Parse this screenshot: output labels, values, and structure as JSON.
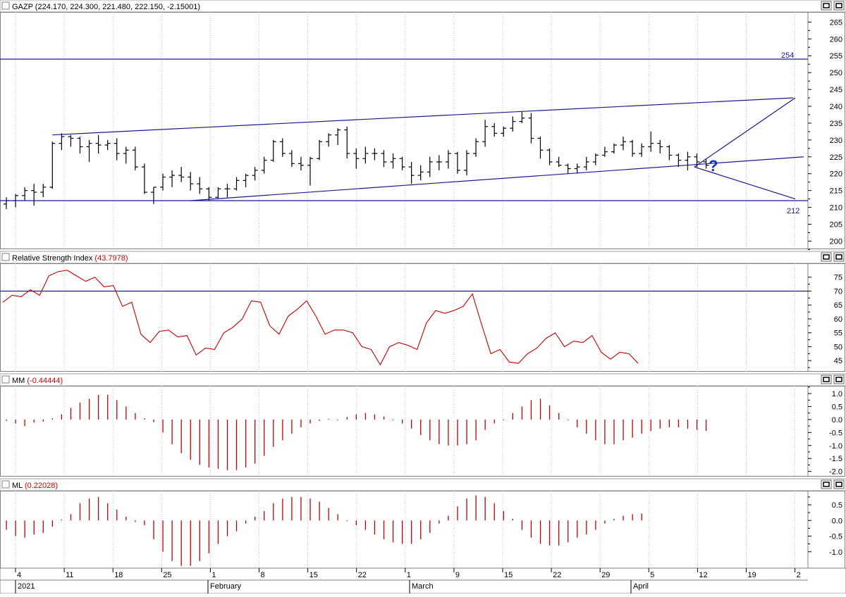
{
  "price_panel": {
    "title": "GAZP (224.170, 224.300, 221.480, 222.150, -2.15001)",
    "level_high_label": "254",
    "level_low_label": "212",
    "question_mark": "?"
  },
  "rsi_panel": {
    "title_prefix": "Relative Strength Index",
    "title_value": "(43.7978)"
  },
  "mm_panel": {
    "title_prefix": "MM",
    "title_value": "(-0.44444)"
  },
  "ml_panel": {
    "title_prefix": "ML",
    "title_value": "(0.22028)"
  },
  "window_buttons": {
    "restore": "□",
    "maximize": "□"
  },
  "colors": {
    "price": "#000000",
    "lines": "#1a1a8c",
    "indicator": "#c00000",
    "grid": "#c0c0c0"
  },
  "chart_data": [
    {
      "type": "ohlc",
      "ticker": "GAZP",
      "ylim": [
        198,
        268
      ],
      "yticks": [
        200,
        205,
        210,
        215,
        220,
        225,
        230,
        235,
        240,
        245,
        250,
        255,
        260,
        265
      ],
      "x_tick_labels": [
        "4",
        "11",
        "18",
        "25",
        "1",
        "8",
        "15",
        "22",
        "1",
        "9",
        "15",
        "22",
        "29",
        "5",
        "12",
        "19",
        "2"
      ],
      "month_labels": [
        "2021",
        "February",
        "March",
        "April"
      ],
      "ohlc": [
        [
          211,
          213,
          209.5,
          212
        ],
        [
          212,
          214,
          210,
          213.5
        ],
        [
          213.5,
          216,
          212,
          215
        ],
        [
          215,
          217,
          210.5,
          214.5
        ],
        [
          214.5,
          217,
          213,
          216
        ],
        [
          216,
          229.5,
          215.5,
          229
        ],
        [
          229,
          232,
          227,
          231
        ],
        [
          231,
          231.5,
          228,
          230.5
        ],
        [
          230.5,
          231,
          226,
          228
        ],
        [
          228,
          230,
          223.5,
          229
        ],
        [
          229,
          231.5,
          226,
          228.5
        ],
        [
          228.5,
          230,
          227,
          229
        ],
        [
          229,
          230.5,
          224,
          226
        ],
        [
          226,
          228,
          223,
          227
        ],
        [
          227,
          228,
          221,
          222
        ],
        [
          222,
          223,
          214,
          214.5
        ],
        [
          214.5,
          216,
          211,
          216
        ],
        [
          216,
          220,
          215,
          219
        ],
        [
          219,
          221,
          216,
          219.5
        ],
        [
          219.5,
          222,
          217.5,
          219
        ],
        [
          219,
          220.5,
          215,
          217
        ],
        [
          217,
          219,
          214,
          215.5
        ],
        [
          215.5,
          216,
          212,
          213
        ],
        [
          213,
          216,
          212.5,
          215.5
        ],
        [
          215.5,
          217,
          213,
          215.5
        ],
        [
          215.5,
          219,
          215,
          218
        ],
        [
          218,
          220,
          216,
          219.5
        ],
        [
          219.5,
          222,
          218,
          221
        ],
        [
          221,
          225,
          220,
          224
        ],
        [
          224,
          230,
          223.5,
          229.5
        ],
        [
          229.5,
          230.5,
          225,
          226
        ],
        [
          226,
          227,
          222,
          223
        ],
        [
          223,
          225,
          221,
          222.5
        ],
        [
          222.5,
          225,
          216.5,
          224.5
        ],
        [
          224.5,
          230,
          224,
          229.5
        ],
        [
          229.5,
          232,
          228,
          231.5
        ],
        [
          231.5,
          233.5,
          228.5,
          233
        ],
        [
          233,
          234,
          224.5,
          226
        ],
        [
          226,
          227.5,
          221.5,
          224.5
        ],
        [
          224.5,
          228,
          223,
          226
        ],
        [
          226,
          227.5,
          224,
          226
        ],
        [
          226,
          227,
          222,
          223.5
        ],
        [
          223.5,
          226,
          221.5,
          224.5
        ],
        [
          224.5,
          225,
          221,
          222
        ],
        [
          222,
          223.5,
          217,
          219.5
        ],
        [
          219.5,
          222.5,
          218,
          220.5
        ],
        [
          220.5,
          225,
          219,
          223.5
        ],
        [
          223.5,
          225.5,
          221,
          223.5
        ],
        [
          223.5,
          227,
          221.5,
          226
        ],
        [
          226,
          226.5,
          220,
          221
        ],
        [
          221,
          227,
          219.5,
          226
        ],
        [
          226,
          230.5,
          225,
          229.5
        ],
        [
          229.5,
          236,
          228,
          234
        ],
        [
          234,
          235,
          231,
          232
        ],
        [
          232,
          234,
          231,
          233.5
        ],
        [
          233.5,
          237,
          232.5,
          235.5
        ],
        [
          235.5,
          238.5,
          235,
          236.5
        ],
        [
          236.5,
          238,
          229,
          230.5
        ],
        [
          230.5,
          231,
          224.5,
          227
        ],
        [
          227,
          227.5,
          222.5,
          223.5
        ],
        [
          223.5,
          225,
          222,
          222.5
        ],
        [
          222.5,
          223,
          220,
          221.5
        ],
        [
          221.5,
          223,
          220,
          222
        ],
        [
          222,
          225,
          221,
          223.5
        ],
        [
          223.5,
          226,
          222.5,
          225.5
        ],
        [
          225.5,
          228,
          225,
          226.5
        ],
        [
          226.5,
          229,
          226,
          228.5
        ],
        [
          228.5,
          231,
          227,
          229.5
        ],
        [
          229.5,
          230,
          225,
          226
        ],
        [
          226,
          229,
          225,
          228
        ],
        [
          228,
          232.5,
          226.5,
          229
        ],
        [
          229,
          230,
          226,
          228
        ],
        [
          228,
          228.5,
          224,
          225.5
        ],
        [
          225.5,
          226,
          222,
          224
        ],
        [
          224,
          226.5,
          221,
          225
        ],
        [
          225,
          226,
          222,
          223.5
        ],
        [
          223.5,
          224.5,
          221.5,
          222.5
        ]
      ],
      "levels": [
        254,
        212
      ],
      "channel_top": {
        "from": [
          5,
          231.5
        ],
        "to": [
          79,
          242.5
        ]
      },
      "channel_bottom": {
        "from": [
          20,
          212
        ],
        "to": [
          79,
          225
        ]
      },
      "projection_up": {
        "from": [
          69,
          222
        ],
        "to": [
          79,
          242.5
        ]
      },
      "projection_down": {
        "from": [
          69,
          222
        ],
        "to": [
          79,
          212.5
        ]
      }
    },
    {
      "type": "line",
      "name": "Relative Strength Index",
      "ylim": [
        41,
        80
      ],
      "yticks": [
        45,
        50,
        55,
        60,
        65,
        70,
        75
      ],
      "reference_line": 70,
      "values": [
        66,
        68.5,
        68,
        70.5,
        68.5,
        75.5,
        77,
        77.5,
        75.5,
        73.5,
        75,
        71.5,
        72,
        64.5,
        66,
        54.5,
        51.5,
        55.5,
        56,
        53.5,
        54,
        47,
        49.5,
        49,
        55,
        57,
        60,
        66.5,
        66,
        57.5,
        54.5,
        61,
        63.5,
        66.5,
        61,
        54.5,
        56,
        56,
        55,
        50,
        49,
        43.5,
        50,
        51.5,
        50.5,
        49,
        58.5,
        63,
        62,
        63,
        64.5,
        69,
        58,
        47.5,
        49,
        44.5,
        44,
        47.5,
        49.5,
        53,
        55,
        50,
        52,
        51.5,
        54,
        48,
        45.5,
        48,
        47.5,
        44
      ]
    },
    {
      "type": "bar",
      "name": "MM",
      "ylim": [
        -2.2,
        1.3
      ],
      "yticks": [
        1.0,
        0.5,
        0.0,
        -0.5,
        -1.0,
        -1.5,
        -2.0
      ],
      "values": [
        -0.05,
        -0.15,
        -0.25,
        -0.12,
        -0.08,
        0.05,
        0.2,
        0.45,
        0.65,
        0.8,
        0.95,
        0.95,
        0.75,
        0.5,
        0.25,
        0.05,
        -0.1,
        -0.5,
        -0.95,
        -1.3,
        -1.55,
        -1.75,
        -1.85,
        -1.9,
        -1.95,
        -1.95,
        -1.85,
        -1.7,
        -1.4,
        -1.05,
        -0.8,
        -0.55,
        -0.3,
        -0.15,
        -0.05,
        0.03,
        0,
        0.1,
        0.2,
        0.25,
        0.2,
        0.12,
        0,
        -0.15,
        -0.35,
        -0.6,
        -0.8,
        -0.95,
        -1.0,
        -1.0,
        -0.95,
        -0.8,
        -0.4,
        -0.15,
        0,
        0.25,
        0.5,
        0.75,
        0.8,
        0.55,
        0.25,
        0,
        -0.3,
        -0.55,
        -0.8,
        -0.95,
        -0.95,
        -0.8,
        -0.7,
        -0.55,
        -0.45,
        -0.35,
        -0.3,
        -0.3,
        -0.35,
        -0.4,
        -0.44
      ]
    },
    {
      "type": "bar",
      "name": "ML",
      "ylim": [
        -1.5,
        0.95
      ],
      "yticks": [
        0.5,
        0.0,
        -0.5,
        -1.0
      ],
      "values": [
        -0.3,
        -0.5,
        -0.55,
        -0.45,
        -0.4,
        -0.2,
        0.03,
        0.2,
        0.55,
        0.7,
        0.75,
        0.55,
        0.35,
        0.12,
        -0.05,
        -0.15,
        -0.6,
        -1.0,
        -1.3,
        -1.45,
        -1.45,
        -1.3,
        -1.05,
        -0.75,
        -0.5,
        -0.35,
        -0.1,
        0.12,
        0.3,
        0.55,
        0.7,
        0.75,
        0.75,
        0.7,
        0.6,
        0.4,
        0.2,
        0,
        -0.15,
        -0.3,
        -0.45,
        -0.6,
        -0.7,
        -0.75,
        -0.75,
        -0.6,
        -0.4,
        -0.1,
        0.15,
        0.45,
        0.7,
        0.8,
        0.75,
        0.55,
        0.3,
        0.05,
        -0.3,
        -0.55,
        -0.75,
        -0.8,
        -0.8,
        -0.7,
        -0.55,
        -0.45,
        -0.3,
        -0.1,
        0.05,
        0.15,
        0.2,
        0.22
      ]
    }
  ]
}
